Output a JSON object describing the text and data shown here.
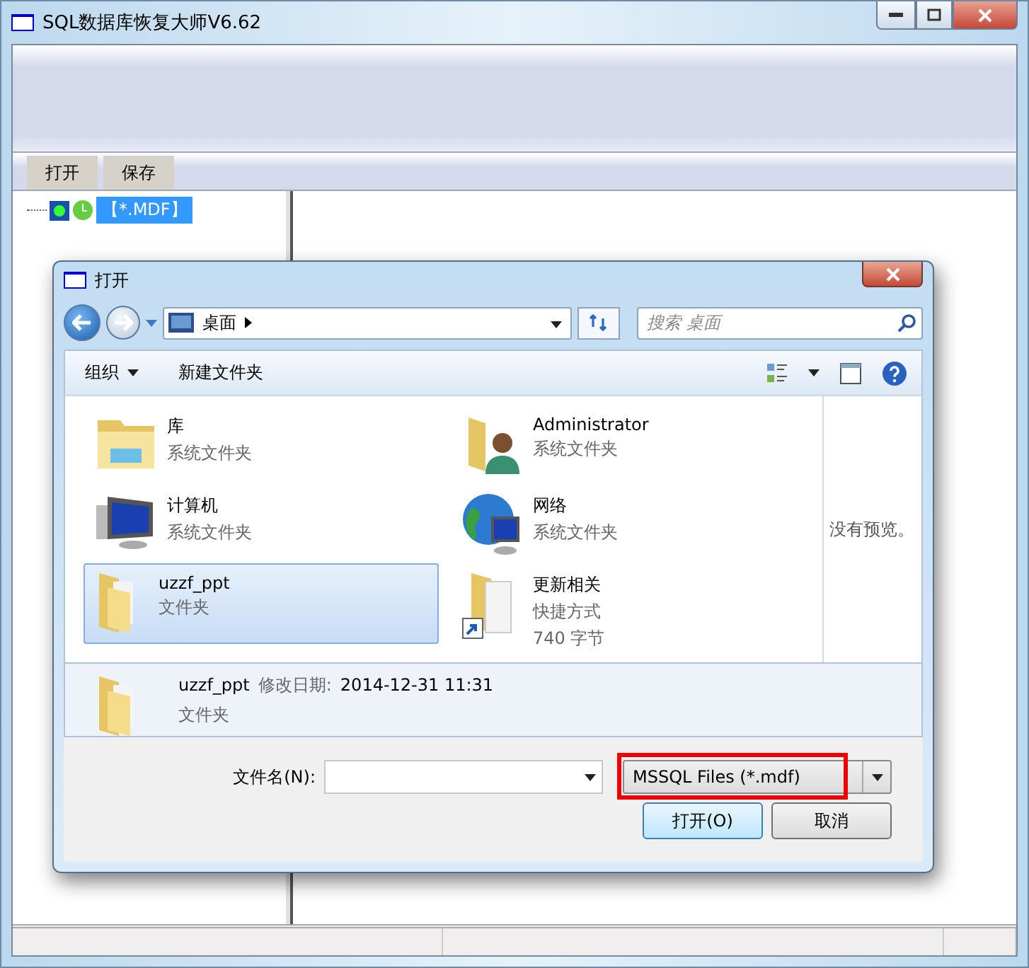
{
  "window": {
    "title": "SQL数据库恢复大师V6.62"
  },
  "toolbar": {
    "buttons": [
      "打开",
      "保存"
    ]
  },
  "tree": {
    "items": [
      {
        "label": "【*.MDF】",
        "selected": true
      }
    ]
  },
  "dialog": {
    "title": "打开",
    "address": {
      "location": "桌面"
    },
    "search": {
      "placeholder": "搜索 桌面"
    },
    "commands": {
      "organize": "组织",
      "new_folder": "新建文件夹"
    },
    "items": [
      {
        "kind": "library",
        "name": "库",
        "line2": "系统文件夹",
        "selected": false
      },
      {
        "kind": "user",
        "name": "Administrator",
        "line2": "系统文件夹",
        "selected": false
      },
      {
        "kind": "computer",
        "name": "计算机",
        "line2": "系统文件夹",
        "selected": false
      },
      {
        "kind": "network",
        "name": "网络",
        "line2": "系统文件夹",
        "selected": false
      },
      {
        "kind": "folder",
        "name": "uzzf_ppt",
        "line2": "文件夹",
        "selected": true
      },
      {
        "kind": "shortcut",
        "name": "更新相关",
        "line2": "快捷方式",
        "line3": "740 字节",
        "selected": false
      }
    ],
    "preview": "没有预览。",
    "details": {
      "name": "uzzf_ppt",
      "date_label": "修改日期:",
      "date": "2014-12-31 11:31",
      "type": "文件夹"
    },
    "filename_label": "文件名(N):",
    "filetype": {
      "value": "MSSQL Files (*.mdf)",
      "highlighted": true
    },
    "buttons": [
      {
        "kind": "primary",
        "label": "打开(O)"
      },
      {
        "kind": "normal",
        "label": "取消"
      }
    ]
  }
}
